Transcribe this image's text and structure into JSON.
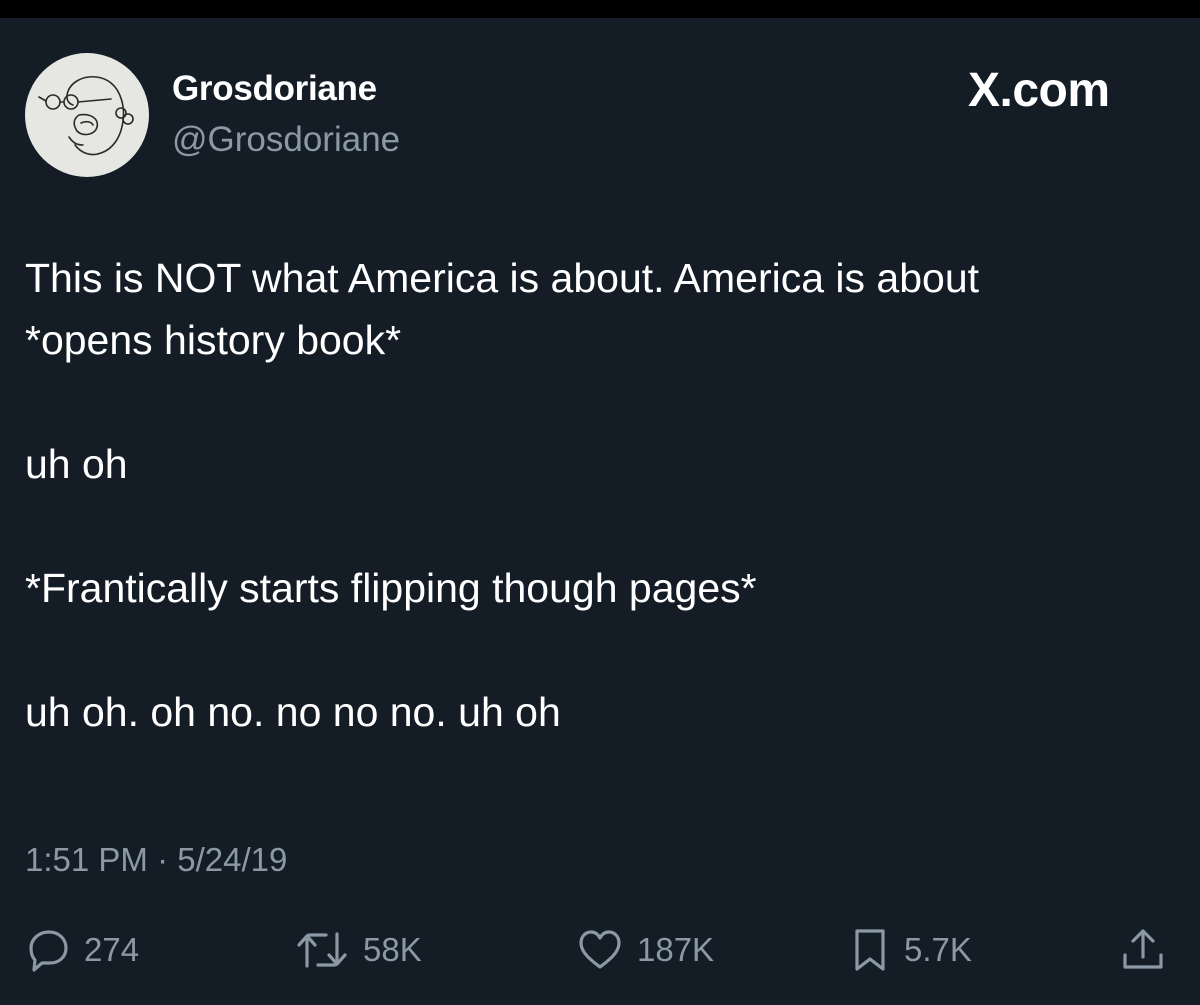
{
  "author": {
    "display_name": "Grosdoriane",
    "handle": "@Grosdoriane"
  },
  "brand": "X.com",
  "tweet": {
    "lines": [
      "This is NOT what America is about. America is about",
      "*opens history book*",
      "uh oh",
      "*Frantically starts flipping though pages*",
      "uh oh. oh no. no no no. uh oh"
    ],
    "timestamp": "1:51 PM · 5/24/19"
  },
  "actions": {
    "replies": "274",
    "reposts": "58K",
    "likes": "187K",
    "bookmarks": "5.7K"
  },
  "icons": [
    "reply-icon",
    "repost-icon",
    "like-icon",
    "bookmark-icon",
    "share-icon"
  ],
  "colors": {
    "background": "#141d26",
    "text": "#ffffff",
    "muted": "#8b98a5"
  }
}
